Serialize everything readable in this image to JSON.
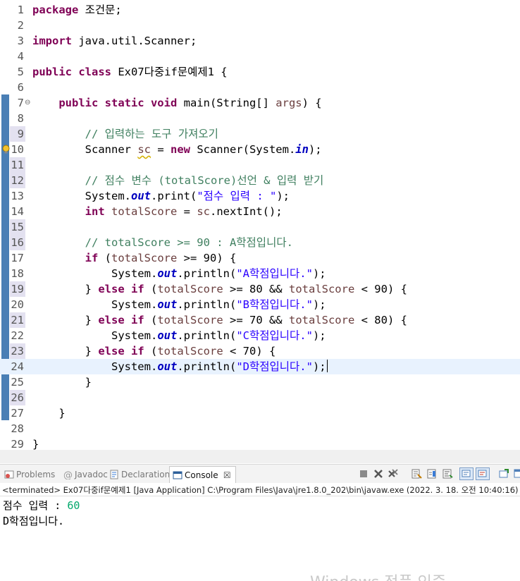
{
  "editor": {
    "lines": [
      {
        "n": "1",
        "segs": [
          [
            "kw",
            "package"
          ],
          [
            "",
            "조건문;"
          ]
        ]
      },
      {
        "n": "2",
        "segs": []
      },
      {
        "n": "3",
        "segs": [
          [
            "kw",
            "import"
          ],
          [
            "",
            "java.util.Scanner;"
          ]
        ]
      },
      {
        "n": "4",
        "segs": []
      },
      {
        "n": "5",
        "segs": [
          [
            "kw",
            "public class"
          ],
          [
            "",
            "Ex07다중if문예제1 {"
          ]
        ]
      },
      {
        "n": "6",
        "segs": []
      },
      {
        "n": "7",
        "fold": true,
        "segs": [
          [
            "",
            "    "
          ],
          [
            "kw",
            "public static void"
          ],
          [
            "",
            " main(String[] "
          ],
          [
            "var",
            "args"
          ],
          [
            "",
            ") {"
          ]
        ]
      },
      {
        "n": "8",
        "segs": []
      },
      {
        "n": "9",
        "mark": true,
        "segs": [
          [
            "cm",
            "        // 입력하는 도구 가져오기"
          ]
        ]
      },
      {
        "n": "10",
        "warn": true,
        "segs": [
          [
            "",
            "        Scanner "
          ],
          [
            "unused",
            "sc"
          ],
          [
            "",
            " = "
          ],
          [
            "kw",
            "new"
          ],
          [
            "",
            " Scanner(System."
          ],
          [
            "fld",
            "in"
          ],
          [
            "",
            ");"
          ]
        ]
      },
      {
        "n": "11",
        "mark": true,
        "segs": []
      },
      {
        "n": "12",
        "mark": true,
        "segs": [
          [
            "cm",
            "        // 점수 변수 (totalScore)선언 & 입력 받기"
          ]
        ]
      },
      {
        "n": "13",
        "segs": [
          [
            "",
            "        System."
          ],
          [
            "fld",
            "out"
          ],
          [
            "",
            ".print("
          ],
          [
            "str",
            "\"점수 입력 : \""
          ],
          [
            "",
            ");"
          ]
        ]
      },
      {
        "n": "14",
        "segs": [
          [
            "",
            "        "
          ],
          [
            "kw",
            "int"
          ],
          [
            "",
            " "
          ],
          [
            "var",
            "totalScore"
          ],
          [
            "",
            " = "
          ],
          [
            "var",
            "sc"
          ],
          [
            "",
            ".nextInt();"
          ]
        ]
      },
      {
        "n": "15",
        "mark": true,
        "segs": []
      },
      {
        "n": "16",
        "mark": true,
        "segs": [
          [
            "cm",
            "        // totalScore >= 90 : A학점입니다."
          ]
        ]
      },
      {
        "n": "17",
        "segs": [
          [
            "",
            "        "
          ],
          [
            "kw",
            "if"
          ],
          [
            "",
            " ("
          ],
          [
            "var",
            "totalScore"
          ],
          [
            "",
            " >= 90) {"
          ]
        ]
      },
      {
        "n": "18",
        "segs": [
          [
            "",
            "            System."
          ],
          [
            "fld",
            "out"
          ],
          [
            "",
            ".println("
          ],
          [
            "str",
            "\"A학점입니다.\""
          ],
          [
            "",
            ");"
          ]
        ]
      },
      {
        "n": "19",
        "mark": true,
        "segs": [
          [
            "",
            "        } "
          ],
          [
            "kw",
            "else if"
          ],
          [
            "",
            " ("
          ],
          [
            "var",
            "totalScore"
          ],
          [
            "",
            " >= 80 && "
          ],
          [
            "var",
            "totalScore"
          ],
          [
            "",
            " < 90) {"
          ]
        ]
      },
      {
        "n": "20",
        "segs": [
          [
            "",
            "            System."
          ],
          [
            "fld",
            "out"
          ],
          [
            "",
            ".println("
          ],
          [
            "str",
            "\"B학점입니다.\""
          ],
          [
            "",
            ");"
          ]
        ]
      },
      {
        "n": "21",
        "mark": true,
        "segs": [
          [
            "",
            "        } "
          ],
          [
            "kw",
            "else if"
          ],
          [
            "",
            " ("
          ],
          [
            "var",
            "totalScore"
          ],
          [
            "",
            " >= 70 && "
          ],
          [
            "var",
            "totalScore"
          ],
          [
            "",
            " < 80) {"
          ]
        ]
      },
      {
        "n": "22",
        "segs": [
          [
            "",
            "            System."
          ],
          [
            "fld",
            "out"
          ],
          [
            "",
            ".println("
          ],
          [
            "str",
            "\"C학점입니다.\""
          ],
          [
            "",
            ");"
          ]
        ]
      },
      {
        "n": "23",
        "mark": true,
        "segs": [
          [
            "",
            "        } "
          ],
          [
            "kw",
            "else if"
          ],
          [
            "",
            " ("
          ],
          [
            "var",
            "totalScore"
          ],
          [
            "",
            " < 70) {"
          ]
        ]
      },
      {
        "n": "24",
        "current": true,
        "caret": true,
        "segs": [
          [
            "",
            "            System."
          ],
          [
            "fld",
            "out"
          ],
          [
            "",
            ".println("
          ],
          [
            "str",
            "\"D학점입니다.\""
          ],
          [
            "",
            ");"
          ]
        ]
      },
      {
        "n": "25",
        "segs": [
          [
            "",
            "        }"
          ]
        ]
      },
      {
        "n": "26",
        "mark": true,
        "segs": []
      },
      {
        "n": "27",
        "segs": [
          [
            "",
            "    }"
          ]
        ]
      },
      {
        "n": "28",
        "segs": []
      },
      {
        "n": "29",
        "segs": [
          [
            "",
            "}"
          ]
        ]
      }
    ]
  },
  "views": {
    "tabs": [
      {
        "label": "Problems",
        "icon": "problems-icon"
      },
      {
        "label": "Javadoc",
        "icon": "javadoc-icon"
      },
      {
        "label": "Declaration",
        "icon": "declaration-icon"
      },
      {
        "label": "Console",
        "icon": "console-icon",
        "active": true
      }
    ],
    "close_glyph": "☒"
  },
  "console": {
    "header": "<terminated> Ex07다중if문예제1 [Java Application] C:\\Program Files\\Java\\jre1.8.0_202\\bin\\javaw.exe (2022. 3. 18. 오전 10:40:16)",
    "prompt": "점수 입력 : ",
    "input": "60",
    "output": "D학점입니다."
  },
  "watermark": "Windows 정품 인증"
}
